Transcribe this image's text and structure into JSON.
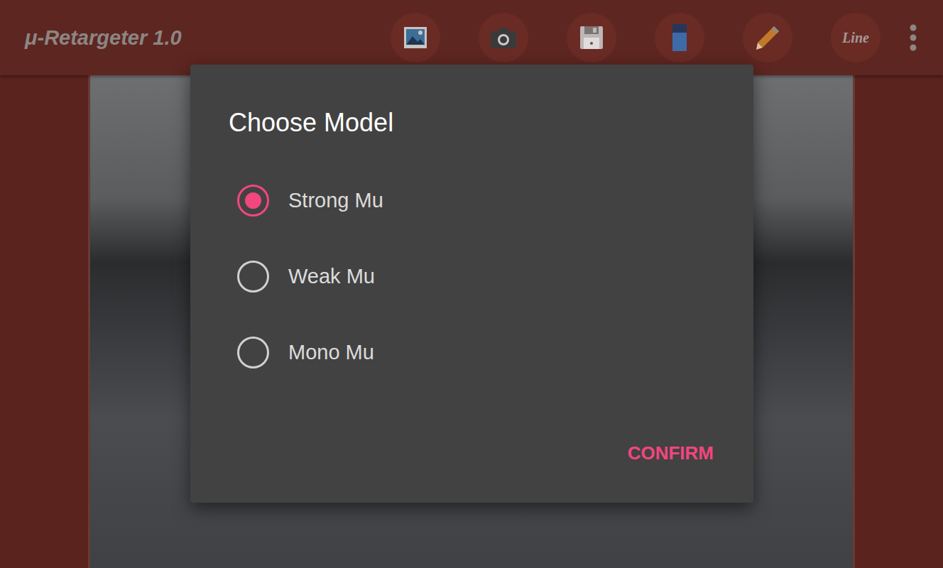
{
  "app_bar": {
    "title": "μ-Retargeter 1.0",
    "line_button": "Line"
  },
  "dialog": {
    "title": "Choose Model",
    "options": [
      {
        "label": "Strong Mu",
        "selected": true
      },
      {
        "label": "Weak Mu",
        "selected": false
      },
      {
        "label": "Mono Mu",
        "selected": false
      }
    ],
    "buttons": [
      "CONFIRM"
    ]
  }
}
